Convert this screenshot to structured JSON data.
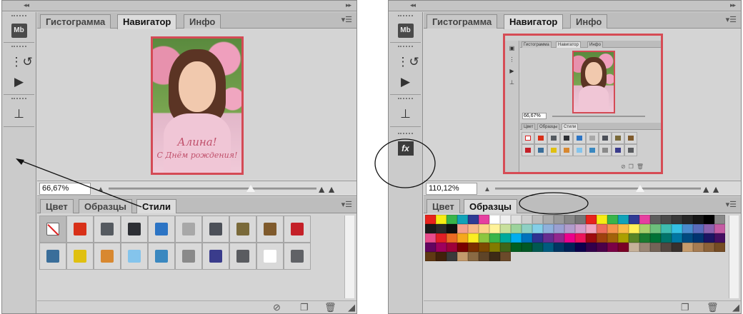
{
  "left": {
    "top_tabs": [
      "Гистограмма",
      "Навигатор",
      "Инфо"
    ],
    "active_top_tab": "Навигатор",
    "zoom_value": "66,67%",
    "zoom_fraction": 0.68,
    "bottom_tabs": [
      "Цвет",
      "Образцы",
      "Стили"
    ],
    "active_bottom_tab": "Стили",
    "photo_caption": [
      "Алина!",
      "С Днём рождения!"
    ],
    "dock_icons": [
      "mini-bridge-icon",
      "history-icon",
      "actions-play-icon",
      "tool-presets-icon"
    ],
    "dock_labels": {
      "mb": "Mb"
    },
    "style_swatches": [
      "none",
      "#d83018",
      "#555a60",
      "#2d2f34",
      "#2c74c4",
      "#a8a8a8",
      "#4c5058",
      "#7a6a3a",
      "#7f5a2c",
      "#c42028",
      "#3a6e9a",
      "#e0c010",
      "#d88830",
      "#84c4ec",
      "#3a88c0",
      "#8a8a8a",
      "#3a3c8c",
      "#5a5c60",
      "#ffffff",
      "#606266"
    ],
    "footer_icons": [
      "clear-style-icon",
      "new-style-icon",
      "delete-icon"
    ]
  },
  "right": {
    "top_tabs": [
      "Гистограмма",
      "Навигатор",
      "Инфо"
    ],
    "active_top_tab": "Навигатор",
    "zoom_value": "110,12%",
    "zoom_fraction": 0.7,
    "bottom_tabs": [
      "Цвет",
      "Образцы"
    ],
    "active_bottom_tab": "Образцы",
    "dock_icons": [
      "mini-bridge-icon",
      "history-icon",
      "actions-play-icon",
      "tool-presets-icon",
      "styles-fx-icon"
    ],
    "dock_labels": {
      "mb": "Mb",
      "fx": "fx"
    },
    "mini": {
      "tabs": [
        "Гистограмма",
        "Навигатор",
        "Инфо"
      ],
      "zoom": "66,67%",
      "bottom_tabs": [
        "Цвет",
        "Образцы",
        "Стили"
      ]
    },
    "swatch_colors": [
      "#e8221c",
      "#f6ec14",
      "#38b44a",
      "#10a2b8",
      "#2e3a94",
      "#e63ea0",
      "#ffffff",
      "#f0f0f0",
      "#e0e0e0",
      "#cfcfcf",
      "#bdbdbd",
      "#ababab",
      "#999999",
      "#878787",
      "#757575",
      "#e8221c",
      "#f6ec14",
      "#38b44a",
      "#10a2b8",
      "#2e3a94",
      "#e63ea0",
      "#5d5d5d",
      "#4a4a4a",
      "#383838",
      "#272727",
      "#161616",
      "#000000",
      "#888888",
      "#1a1a1a",
      "#2a2a2a",
      "#101010",
      "#f4a08c",
      "#f8b888",
      "#fcd488",
      "#fff29a",
      "#c8e09c",
      "#9cd39c",
      "#8ed0c4",
      "#84cfe8",
      "#8fb1dc",
      "#9aa0d2",
      "#b29ccc",
      "#d0a0cc",
      "#f0a4c0",
      "#ec6c5c",
      "#f4944c",
      "#f8bc48",
      "#fff058",
      "#a8d06c",
      "#6cc07c",
      "#3ebcb0",
      "#34c0e4",
      "#4a8cce",
      "#5a6cbc",
      "#8a60ae",
      "#c45ca4",
      "#e84c8c",
      "#e21f26",
      "#ec6b23",
      "#f6a81d",
      "#fbee23",
      "#8cc63f",
      "#39b54a",
      "#00a99d",
      "#00aeef",
      "#0072bc",
      "#2e3192",
      "#662d91",
      "#92278f",
      "#ec008c",
      "#ed145b",
      "#9e0b0f",
      "#a0410d",
      "#a36209",
      "#aba000",
      "#598527",
      "#197b30",
      "#007236",
      "#00746b",
      "#0076a3",
      "#004a80",
      "#003471",
      "#1b1464",
      "#440e62",
      "#630460",
      "#9e005d",
      "#9e0039",
      "#790000",
      "#7b2e00",
      "#7d4900",
      "#827b00",
      "#406618",
      "#005e20",
      "#005826",
      "#005952",
      "#005b7f",
      "#003663",
      "#002157",
      "#0d004c",
      "#32004b",
      "#4b0049",
      "#7b0046",
      "#7a0026",
      "#c7b299",
      "#998675",
      "#736357",
      "#534741",
      "#37302d",
      "#c69c6d",
      "#a67c52",
      "#8c6239",
      "#754c24",
      "#603913",
      "#42210b",
      "#3a3a3a",
      "#c49a6c",
      "#8a6a44",
      "#5e4428",
      "#3d2a16",
      "#6b4a2a"
    ],
    "footer_icons": [
      "new-swatch-icon",
      "delete-icon"
    ]
  }
}
